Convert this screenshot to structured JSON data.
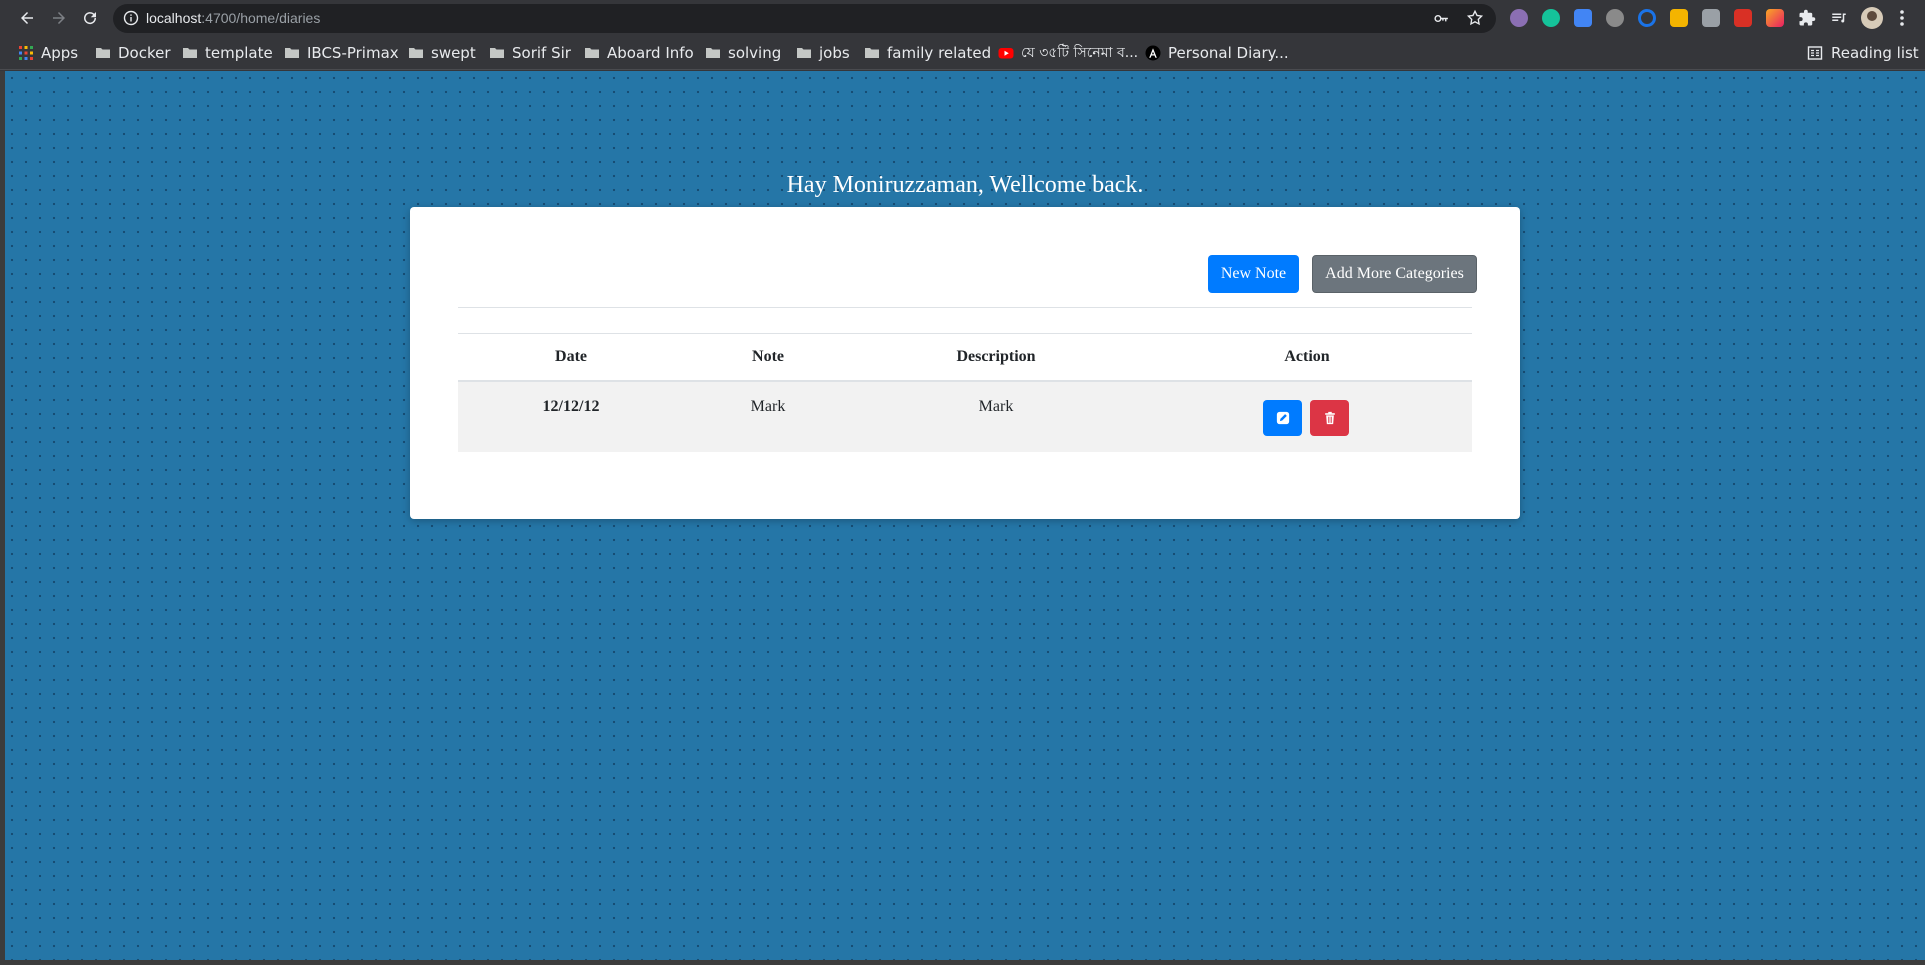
{
  "browser": {
    "url_host": "localhost",
    "url_path": ":4700/home/diaries",
    "bookmarks": [
      "Apps",
      "Docker",
      "template",
      "IBCS-Primax",
      "swept",
      "Sorif Sir",
      "Aboard Info",
      "solving",
      "jobs",
      "family related",
      "যে ৩৫টি সিনেমা ব...",
      "Personal Diary..."
    ],
    "reading_list": "Reading list"
  },
  "page": {
    "welcome": "Hay Moniruzzaman, Wellcome back.",
    "toolbar": {
      "new_note": "New Note",
      "add_categories": "Add More Categories"
    },
    "table": {
      "headers": [
        "Date",
        "Note",
        "Description",
        "Action"
      ],
      "rows": [
        {
          "date": "12/12/12",
          "note": "Mark",
          "description": "Mark"
        }
      ]
    }
  },
  "colors": {
    "page_background": "#2576a7",
    "primary": "#007bff",
    "secondary": "#6c757d",
    "danger": "#dc3545"
  }
}
